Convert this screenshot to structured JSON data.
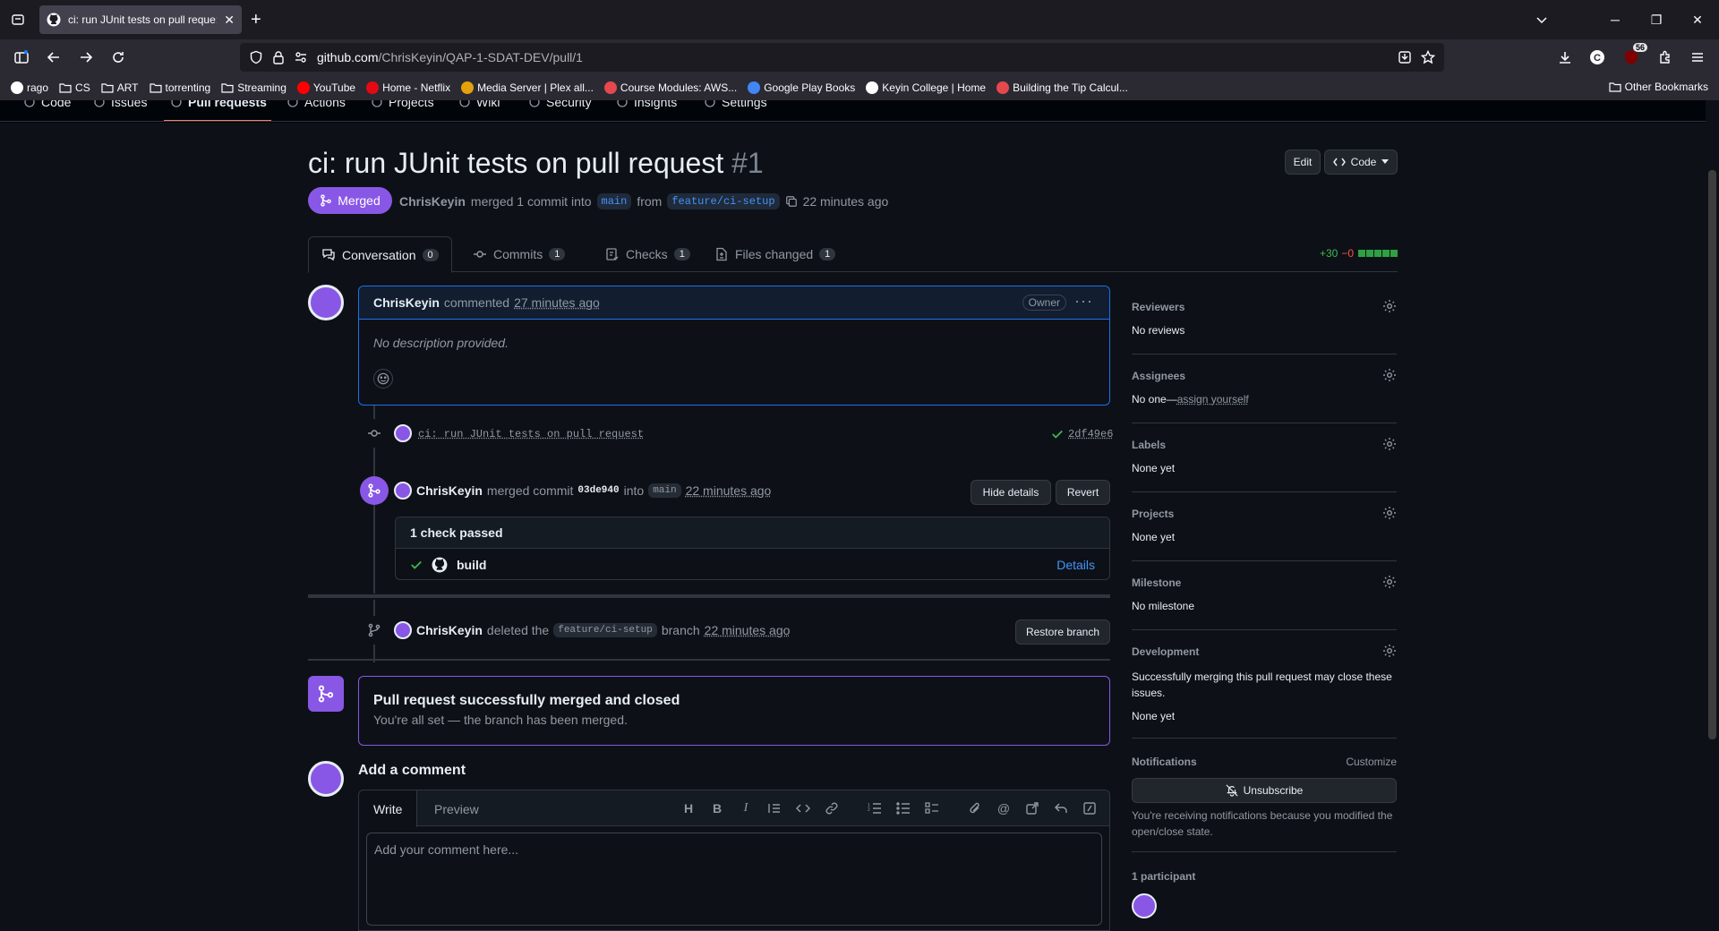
{
  "browser": {
    "tab_title": "ci: run JUnit tests on pull reque:",
    "url_host": "github.com",
    "url_path": "/ChrisKeyin/QAP-1-SDAT-DEV/pull/1",
    "extension_badge": "56",
    "bookmarks": [
      {
        "label": "rago",
        "icon": "google-icon",
        "color": "#ffffff"
      },
      {
        "label": "CS",
        "icon": "folder-icon"
      },
      {
        "label": "ART",
        "icon": "folder-icon"
      },
      {
        "label": "torrenting",
        "icon": "folder-icon"
      },
      {
        "label": "Streaming",
        "icon": "folder-icon"
      },
      {
        "label": "YouTube",
        "icon": "youtube-icon",
        "color": "#ff0000"
      },
      {
        "label": "Home - Netflix",
        "icon": "netflix-icon",
        "color": "#e50914"
      },
      {
        "label": "Media Server | Plex all...",
        "icon": "plex-icon",
        "color": "#e5a00d"
      },
      {
        "label": "Course Modules: AWS...",
        "icon": "aws-icon",
        "color": "#e5484d"
      },
      {
        "label": "Google Play Books",
        "icon": "play-books-icon",
        "color": "#4285f4"
      },
      {
        "label": "Keyin College | Home",
        "icon": "keyin-icon",
        "color": "#ffffff"
      },
      {
        "label": "Building the Tip Calcul...",
        "icon": "odin-icon",
        "color": "#e5484d"
      }
    ],
    "other_bookmarks": "Other Bookmarks"
  },
  "repo_nav": {
    "items": [
      "Code",
      "Issues",
      "Pull requests",
      "Actions",
      "Projects",
      "Wiki",
      "Security",
      "Insights",
      "Settings"
    ],
    "active": "Pull requests"
  },
  "pr": {
    "title": "ci: run JUnit tests on pull request",
    "number": "#1",
    "edit_label": "Edit",
    "code_label": "Code",
    "state": "Merged",
    "author": "ChrisKeyin",
    "merge_text": "merged 1 commit into",
    "base_branch": "main",
    "from_text": "from",
    "head_branch": "feature/ci-setup",
    "time": "22 minutes ago"
  },
  "tabs": [
    {
      "label": "Conversation",
      "count": "0",
      "icon": "comment-discussion-icon"
    },
    {
      "label": "Commits",
      "count": "1",
      "icon": "git-commit-icon"
    },
    {
      "label": "Checks",
      "count": "1",
      "icon": "checklist-icon"
    },
    {
      "label": "Files changed",
      "count": "1",
      "icon": "file-diff-icon"
    }
  ],
  "diffstat": {
    "additions": "+30",
    "deletions": "−0"
  },
  "comment": {
    "author": "ChrisKeyin",
    "action": "commented",
    "time": "27 minutes ago",
    "role": "Owner",
    "body": "No description provided."
  },
  "commit_event": {
    "message": "ci: run JUnit tests on pull request",
    "sha": "2df49e6"
  },
  "merge_event": {
    "author": "ChrisKeyin",
    "text": "merged commit",
    "sha": "03de940",
    "into": "into",
    "branch": "main",
    "time": "22 minutes ago",
    "hide_details": "Hide details",
    "revert": "Revert"
  },
  "checks": {
    "header": "1 check passed",
    "name": "build",
    "details": "Details"
  },
  "delete_event": {
    "author": "ChrisKeyin",
    "text": "deleted the",
    "branch": "feature/ci-setup",
    "suffix": "branch",
    "time": "22 minutes ago",
    "restore": "Restore branch"
  },
  "merged_box": {
    "title": "Pull request successfully merged and closed",
    "subtitle": "You're all set — the branch has been merged."
  },
  "add_comment": {
    "title": "Add a comment",
    "write": "Write",
    "preview": "Preview",
    "placeholder": "Add your comment here..."
  },
  "sidebar": {
    "reviewers": {
      "title": "Reviewers",
      "value": "No reviews"
    },
    "assignees": {
      "title": "Assignees",
      "value_prefix": "No one—",
      "link": "assign yourself"
    },
    "labels": {
      "title": "Labels",
      "value": "None yet"
    },
    "projects": {
      "title": "Projects",
      "value": "None yet"
    },
    "milestone": {
      "title": "Milestone",
      "value": "No milestone"
    },
    "development": {
      "title": "Development",
      "desc": "Successfully merging this pull request may close these issues.",
      "value": "None yet"
    },
    "notifications": {
      "title": "Notifications",
      "customize": "Customize",
      "button": "Unsubscribe",
      "reason": "You're receiving notifications because you modified the open/close state."
    },
    "participants": {
      "title": "1 participant"
    }
  },
  "colors": {
    "merged_purple": "#8957e5",
    "accent_blue": "#4493f8",
    "success_green": "#3fb950"
  }
}
